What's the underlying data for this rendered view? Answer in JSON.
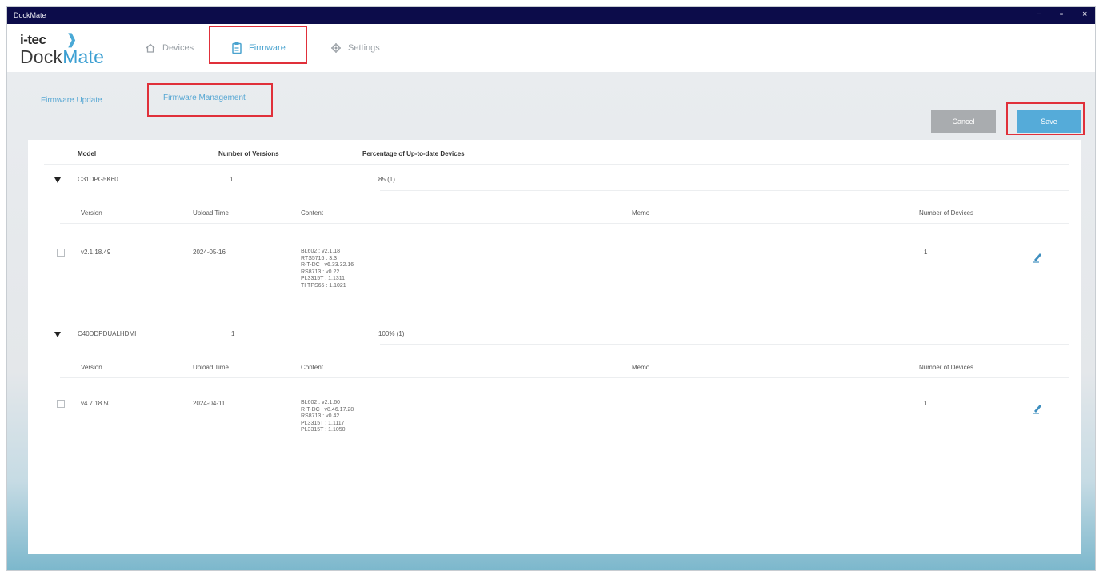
{
  "window": {
    "title": "DockMate",
    "controls": [
      "−",
      "▫",
      "×"
    ]
  },
  "brand": {
    "logo_top": "i-tec",
    "logo_main_dock": "Dock",
    "logo_main_mate": "Mate",
    "accent": "#4aa3cf"
  },
  "nav": {
    "items": [
      {
        "label": "Devices",
        "icon": "home-icon",
        "active": false
      },
      {
        "label": "Firmware",
        "icon": "clipboard-icon",
        "active": true
      },
      {
        "label": "Settings",
        "icon": "gear-icon",
        "active": false
      }
    ]
  },
  "subtabs": {
    "items": [
      {
        "label": "Firmware Update"
      },
      {
        "label": "Firmware Management"
      }
    ]
  },
  "actions": {
    "cancel_label": "Cancel",
    "save_label": "Save"
  },
  "table": {
    "headers": [
      "Model",
      "Number of Versions",
      "Percentage of Up-to-date Devices"
    ],
    "groups": [
      {
        "model": "C31DPG5K60",
        "versions": "1",
        "percentage": "85 (1)",
        "sub_headers": [
          "Version",
          "Upload Time",
          "Content",
          "Memo",
          "Number of Devices"
        ],
        "rows": [
          {
            "version": "v2.1.18.49",
            "upload_time": "2024-05-16",
            "content": [
              "BL602 : v2.1.18",
              "RTS5716 : 3.3",
              "R-T-DC : v6.33.32.16",
              "RS8713 : v0.22",
              "PL3315T : 1.1311",
              "TI TPS65 : 1.1021"
            ],
            "memo": "",
            "devices": "1"
          }
        ]
      },
      {
        "model": "C40DDPDUALHDMI",
        "versions": "1",
        "percentage": "100% (1)",
        "sub_headers": [
          "Version",
          "Upload Time",
          "Content",
          "Memo",
          "Number of Devices"
        ],
        "rows": [
          {
            "version": "v4.7.18.50",
            "upload_time": "2024-04-11",
            "content": [
              "BL602 : v2.1.60",
              "R-T-DC : v8.46.17.28",
              "RS8713 : v0.42",
              "PL3315T : 1.1117",
              "PL3315T : 1.1050"
            ],
            "memo": "",
            "devices": "1"
          }
        ]
      }
    ]
  }
}
